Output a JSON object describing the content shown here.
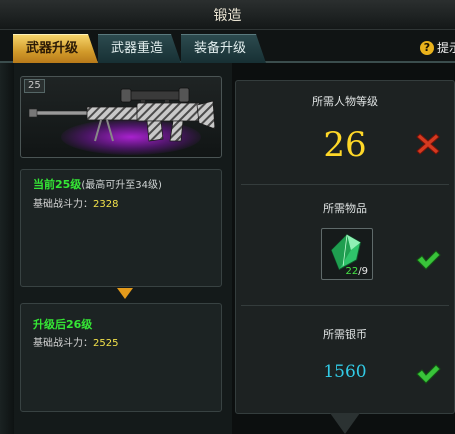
{
  "window": {
    "title": "锻造"
  },
  "tabs": [
    {
      "label": "武器升级",
      "active": true
    },
    {
      "label": "武器重造",
      "active": false
    },
    {
      "label": "装备升级",
      "active": false
    }
  ],
  "help": {
    "icon": "question-icon",
    "label": "提示"
  },
  "weapon": {
    "level_tag": "25"
  },
  "current": {
    "title": "当前25级",
    "note": "(最高可升至34级)",
    "power_label": "基础战斗力：",
    "power_value": "2328"
  },
  "after": {
    "title": "升级后26级",
    "power_label": "基础战斗力：",
    "power_value": "2525"
  },
  "requirements": {
    "level": {
      "label": "所需人物等级",
      "value": "26",
      "met": false,
      "status_icon": "red-cross-icon"
    },
    "item": {
      "label": "所需物品",
      "have": "22",
      "need": "/9",
      "met": true,
      "status_icon": "green-check-icon"
    },
    "silver": {
      "label": "所需银币",
      "value": "1560",
      "met": true,
      "status_icon": "green-check-icon"
    }
  },
  "colors": {
    "accent_gold": "#e9b21c",
    "ok_green": "#35e635",
    "error_red": "#d43a20",
    "silver_cyan": "#32cbe6",
    "level_yellow": "#ffd828"
  }
}
